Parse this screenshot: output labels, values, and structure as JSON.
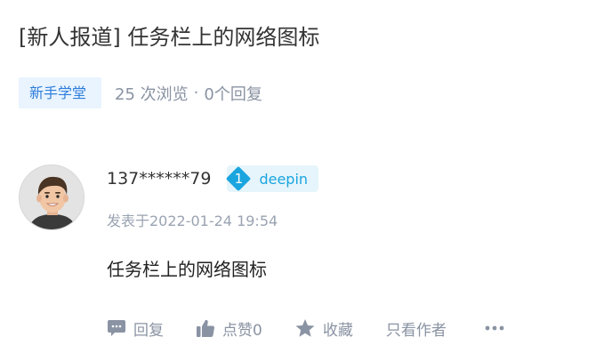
{
  "post": {
    "title": "[新人报道] 任务栏上的网络图标",
    "category": "新手学堂",
    "views_text": "25 次浏览",
    "separator": "·",
    "replies_text": "0个回复"
  },
  "reply": {
    "username": "137******79",
    "badge": {
      "level": "1",
      "name": "deepin",
      "color": "#1aa5df"
    },
    "posted_at": "发表于2022-01-24 19:54",
    "content": "任务栏上的网络图标",
    "actions": {
      "reply": "回复",
      "like": "点赞0",
      "favorite": "收藏",
      "author_only": "只看作者",
      "more": "•••"
    }
  },
  "colors": {
    "accent": "#2e7ddb",
    "tag_bg": "#e9f4ff",
    "muted": "#8a93a3"
  },
  "icons": [
    "speech-bubble-icon",
    "thumbs-up-icon",
    "star-icon",
    "more-dots-icon",
    "user-avatar"
  ]
}
